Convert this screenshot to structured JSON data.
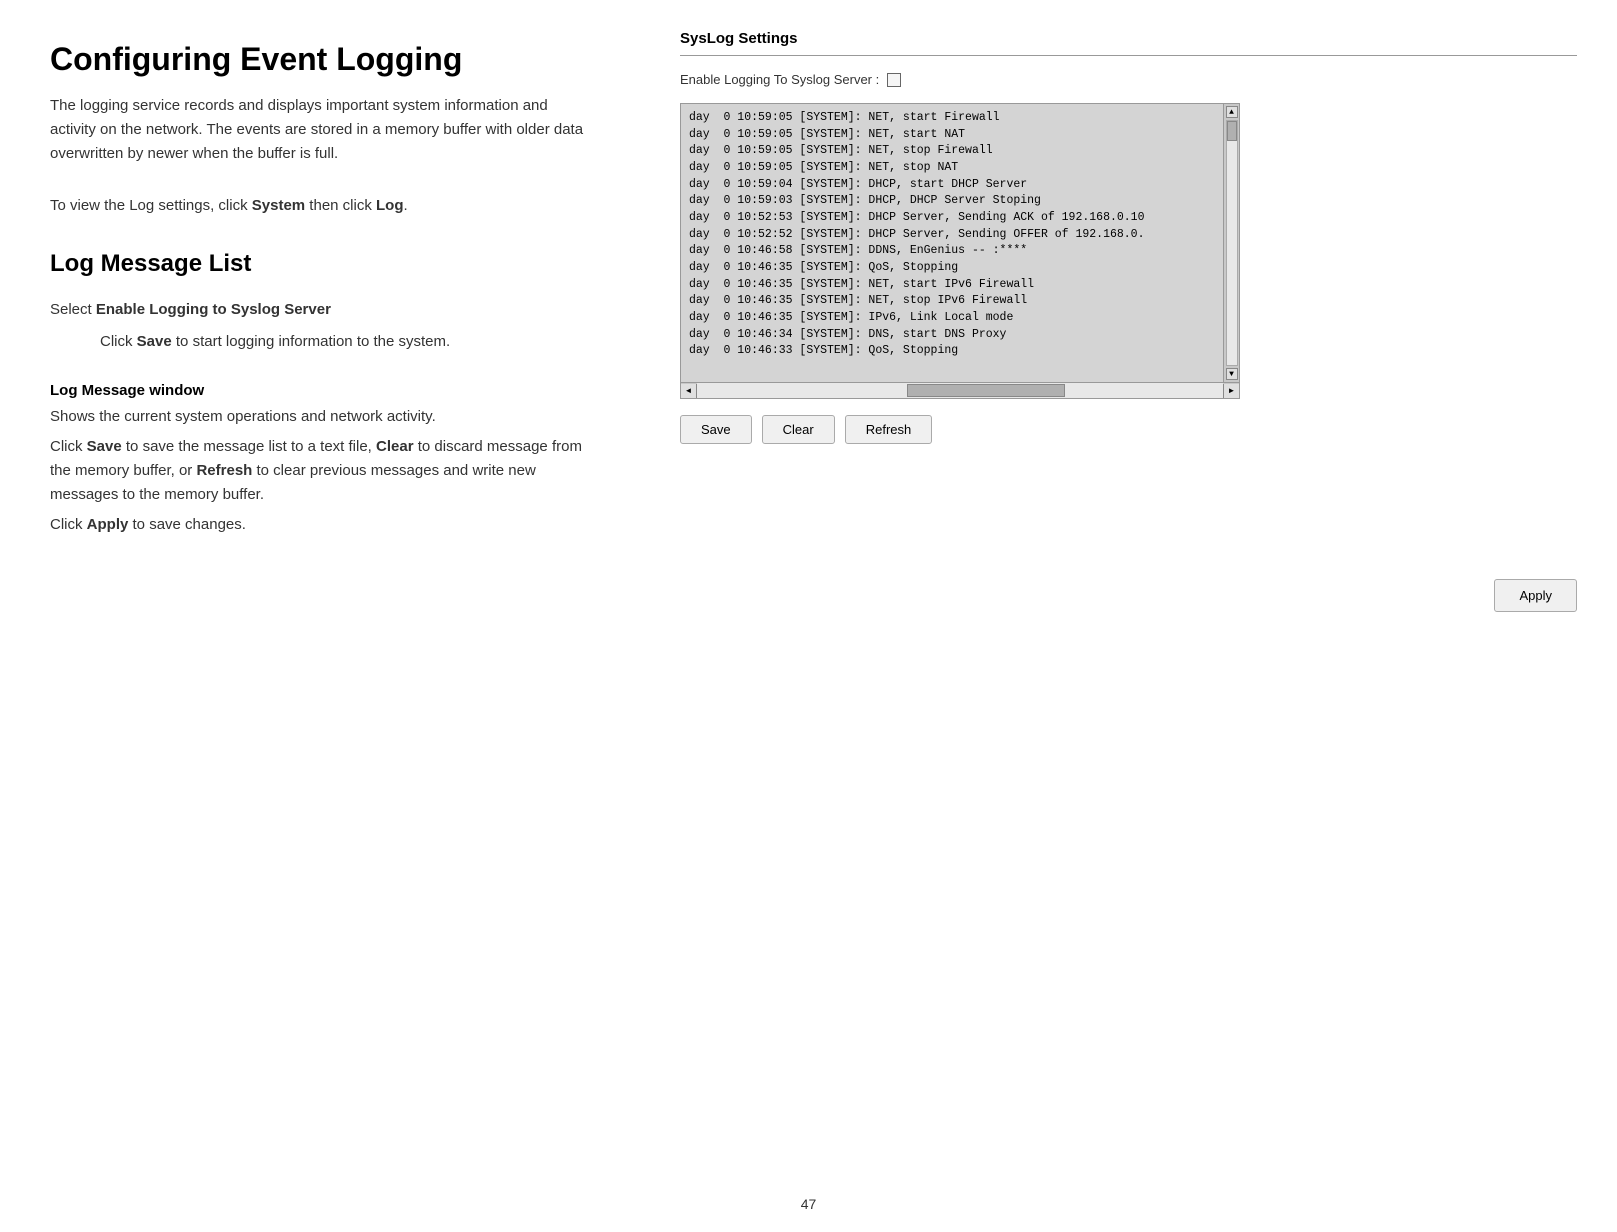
{
  "left": {
    "page_title": "Configuring Event Logging",
    "intro_text": "The logging service records and displays important system information and activity on the network. The events are stored in a memory buffer with older data overwritten by newer when the buffer is full.",
    "view_log_prefix": "To view the Log settings, click ",
    "view_log_system": "System",
    "view_log_middle": " then click ",
    "view_log_log": "Log",
    "view_log_suffix": ".",
    "log_message_list_title": "Log Message List",
    "select_prefix": "Select ",
    "select_bold": "Enable Logging to Syslog Server",
    "click_save_prefix": "Click ",
    "click_save_bold": "Save",
    "click_save_suffix": " to start logging information to the system.",
    "log_window_title": "Log Message window",
    "log_window_desc1": "Shows the current system operations and network activity.",
    "log_window_desc2_prefix": "Click ",
    "log_window_save": "Save",
    "log_window_desc2_middle": " to save the message list to a text file, ",
    "log_window_clear": "Clear",
    "log_window_desc2_middle2": " to discard message from the memory buffer, or ",
    "log_window_refresh": "Refresh",
    "log_window_desc2_suffix": " to clear previous messages and write new messages to the memory buffer.",
    "log_window_desc3_prefix": "Click ",
    "log_window_apply": "Apply",
    "log_window_desc3_suffix": " to save changes.",
    "page_number": "47"
  },
  "right": {
    "settings_title": "SysLog Settings",
    "enable_logging_label": "Enable Logging To Syslog Server :",
    "log_lines": [
      "day  0 10:59:05 [SYSTEM]: NET, start Firewall",
      "day  0 10:59:05 [SYSTEM]: NET, start NAT",
      "day  0 10:59:05 [SYSTEM]: NET, stop Firewall",
      "day  0 10:59:05 [SYSTEM]: NET, stop NAT",
      "day  0 10:59:04 [SYSTEM]: DHCP, start DHCP Server",
      "day  0 10:59:03 [SYSTEM]: DHCP, DHCP Server Stoping",
      "day  0 10:52:53 [SYSTEM]: DHCP Server, Sending ACK of 192.168.0.10",
      "day  0 10:52:52 [SYSTEM]: DHCP Server, Sending OFFER of 192.168.0.",
      "day  0 10:46:58 [SYSTEM]: DDNS, EnGenius -- :****",
      "day  0 10:46:35 [SYSTEM]: QoS, Stopping",
      "day  0 10:46:35 [SYSTEM]: NET, start IPv6 Firewall",
      "day  0 10:46:35 [SYSTEM]: NET, stop IPv6 Firewall",
      "day  0 10:46:35 [SYSTEM]: IPv6, Link Local mode",
      "day  0 10:46:34 [SYSTEM]: DNS, start DNS Proxy",
      "day  0 10:46:33 [SYSTEM]: QoS, Stopping"
    ],
    "buttons": {
      "save": "Save",
      "clear": "Clear",
      "refresh": "Refresh",
      "apply": "Apply"
    }
  }
}
